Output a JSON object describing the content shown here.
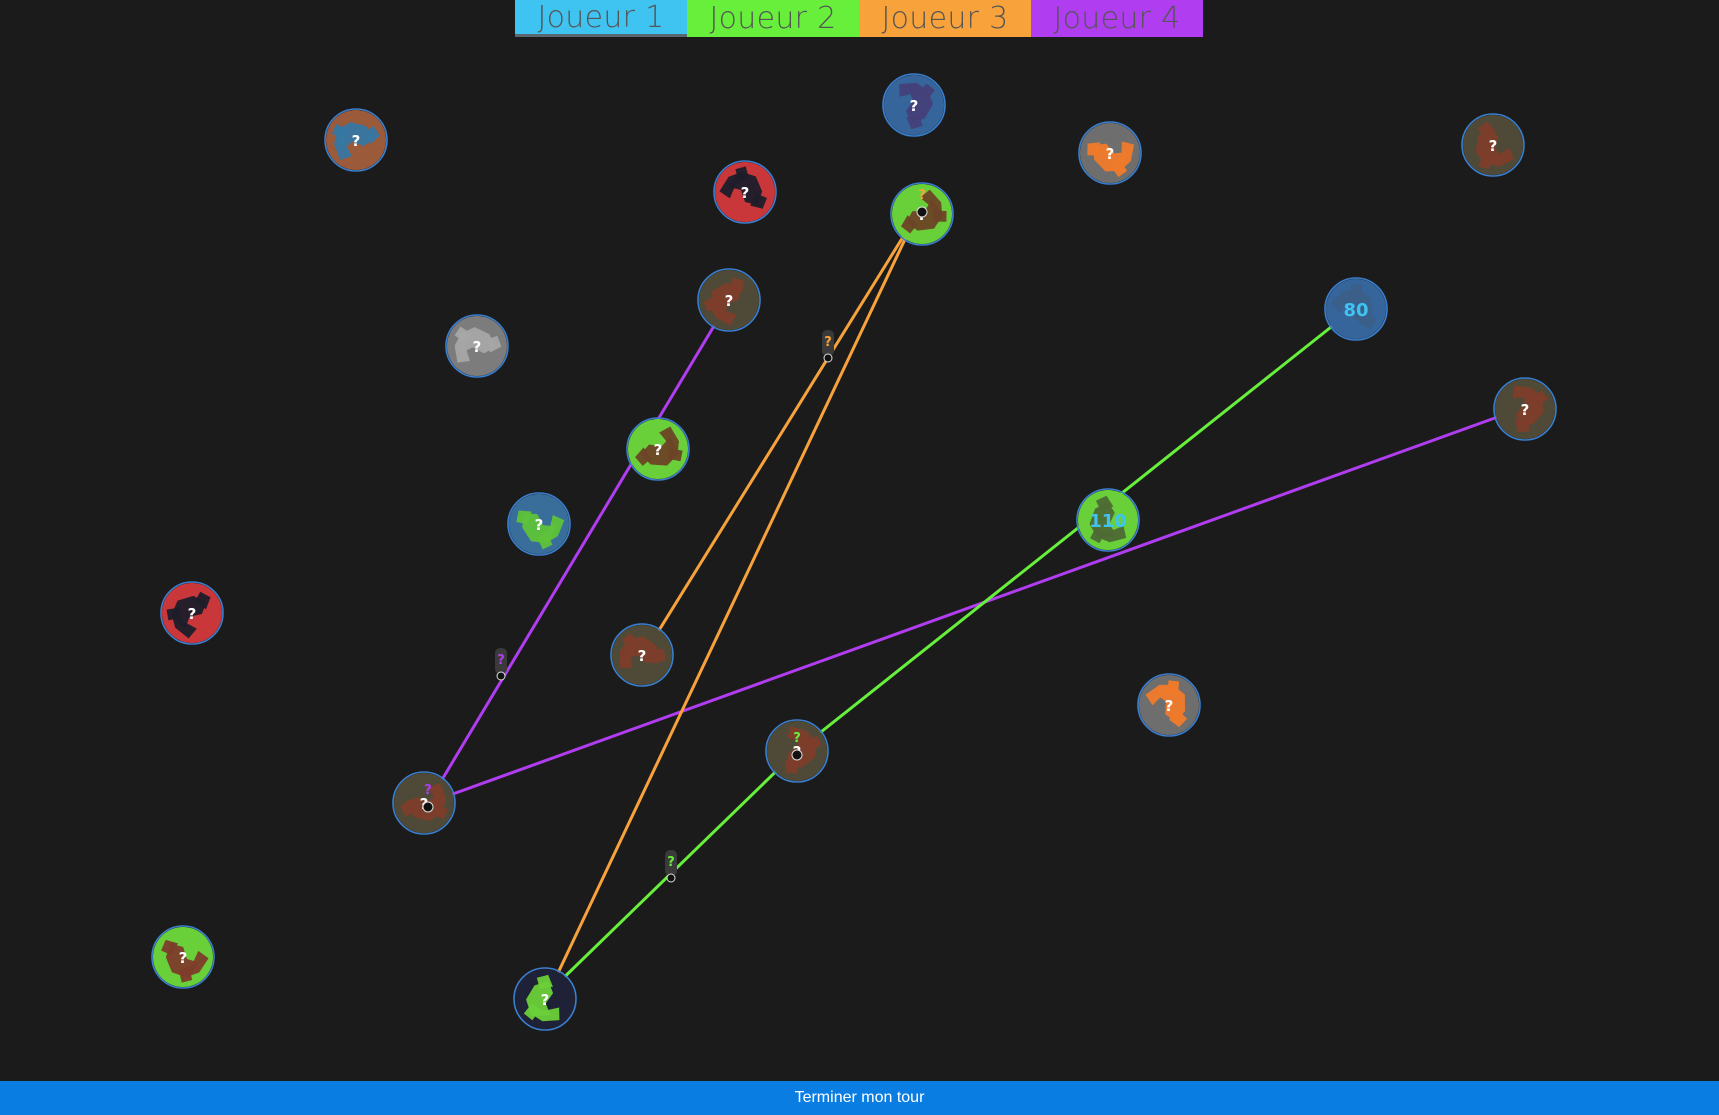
{
  "players": [
    {
      "label": "Joueur 1",
      "color": "#3fc3f1",
      "active": true
    },
    {
      "label": "Joueur 2",
      "color": "#67ef3c",
      "active": false
    },
    {
      "label": "Joueur 3",
      "color": "#f8a23c",
      "active": false
    },
    {
      "label": "Joueur 4",
      "color": "#b03df0",
      "active": false
    }
  ],
  "planets": [
    {
      "name": "planet-brown-blue-1",
      "label": "?",
      "base": "#9b5a3a",
      "land": "#3677a3"
    },
    {
      "name": "planet-red-1",
      "label": "?",
      "base": "#c9373a",
      "land": "#1e1e2a"
    },
    {
      "name": "planet-blue-1",
      "label": "?",
      "base": "#36659b",
      "land": "#45407a"
    },
    {
      "name": "planet-green-target",
      "label": "?",
      "base": "#6ad039",
      "land": "#6d4326"
    },
    {
      "name": "planet-orange-1",
      "label": "?",
      "base": "#6e6e6e",
      "land": "#ef7a2a"
    },
    {
      "name": "planet-olive-1",
      "label": "?",
      "base": "#4e4a37",
      "land": "#7d3d2a"
    },
    {
      "name": "planet-olive-2",
      "label": "?",
      "base": "#4e4a37",
      "land": "#7d3d2a"
    },
    {
      "name": "planet-grey-1",
      "label": "?",
      "base": "#7c7c7c",
      "land": "#a6a6a6"
    },
    {
      "name": "planet-player1-home",
      "label": "80",
      "base": "#36659b",
      "land": "#3b5f88",
      "owned": true
    },
    {
      "name": "planet-olive-3",
      "label": "?",
      "base": "#4e4a37",
      "land": "#7d3d2a"
    },
    {
      "name": "planet-green-1",
      "label": "?",
      "base": "#6ad039",
      "land": "#6d4326"
    },
    {
      "name": "planet-blue-green-1",
      "label": "?",
      "base": "#3a6e9a",
      "land": "#5ec23a"
    },
    {
      "name": "planet-player1-colony",
      "label": "110",
      "base": "#6ad039",
      "land": "#4e6a35",
      "owned": true
    },
    {
      "name": "planet-red-2",
      "label": "?",
      "base": "#c9373a",
      "land": "#1e1e2a"
    },
    {
      "name": "planet-olive-4",
      "label": "?",
      "base": "#4e4a37",
      "land": "#7d3d2a"
    },
    {
      "name": "planet-orange-2",
      "label": "?",
      "base": "#6e6e6e",
      "land": "#ef7a2a"
    },
    {
      "name": "planet-olive-5",
      "label": "?",
      "base": "#4e4a37",
      "land": "#7d3d2a"
    },
    {
      "name": "planet-olive-6",
      "label": "?",
      "base": "#4e4a37",
      "land": "#7d3d2a"
    },
    {
      "name": "planet-green-2",
      "label": "?",
      "base": "#6ad039",
      "land": "#7d3d2a"
    },
    {
      "name": "planet-green-dark-1",
      "label": "?",
      "base": "#1f2236",
      "land": "#6ad039"
    }
  ],
  "fleets": [
    {
      "name": "fleet-purple",
      "label": "?",
      "color": "#b03df0"
    },
    {
      "name": "fleet-orange",
      "label": "?",
      "color": "#f8a23c"
    },
    {
      "name": "fleet-green",
      "label": "?",
      "color": "#67ef3c"
    }
  ],
  "end_turn_label": "Terminer mon tour"
}
